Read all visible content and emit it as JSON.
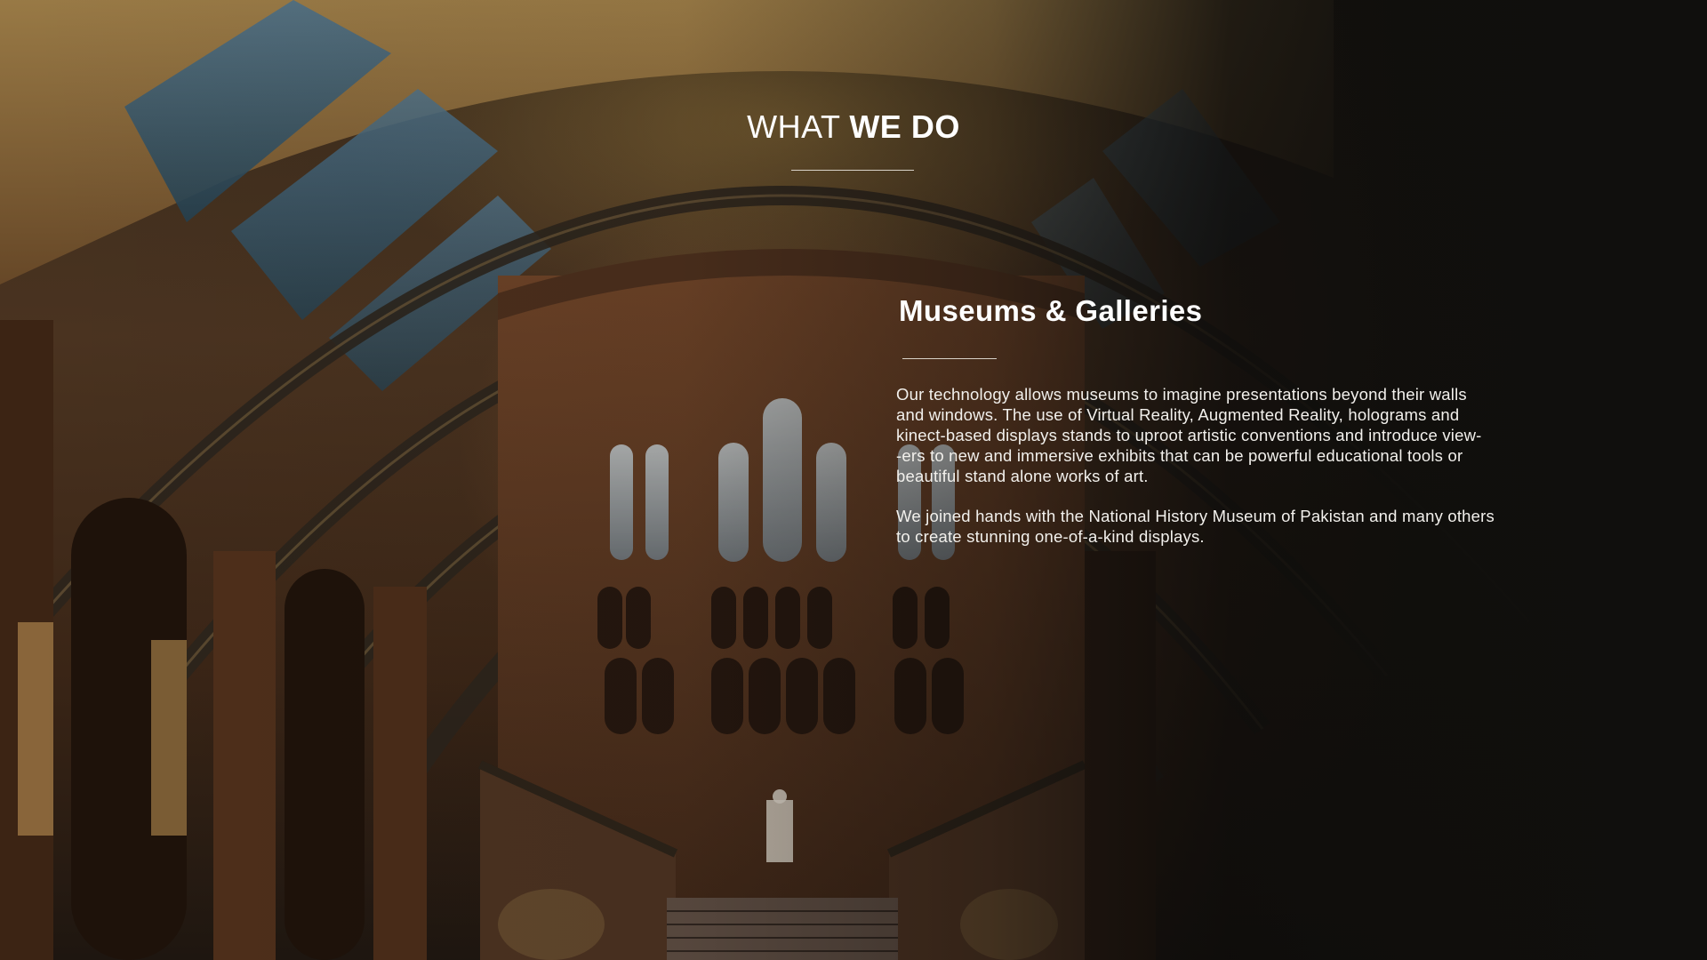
{
  "heading": {
    "light": "WHAT ",
    "bold": "WE DO"
  },
  "section": {
    "title": "Museums & Galleries",
    "paragraph_1_lines": [
      "Our technology allows museums to imagine presentations beyond their walls",
      "and windows. The use of Virtual Reality, Augmented Reality, holograms and",
      "kinect-based displays stands to uproot artistic conventions and introduce view-",
      "-ers to new and immersive exhibits that can be powerful educational tools or",
      "beautiful stand alone works of art."
    ],
    "paragraph_2_lines": [
      "We joined hands with the National History Museum of Pakistan and many others",
      "to create stunning one-of-a-kind displays."
    ]
  },
  "colors": {
    "text": "#ffffff",
    "rule": "#d8d2c8",
    "background_dark": "#10100e"
  },
  "background_image": "museum-hall-photo"
}
